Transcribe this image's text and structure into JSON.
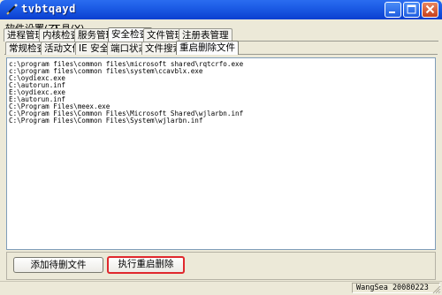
{
  "window": {
    "title": "tvbtqayd",
    "colors": {
      "titlebar": "#0a3fd0",
      "highlight_border": "#e0282d",
      "face": "#ece9d8"
    }
  },
  "menu": [
    {
      "label": "软件设置(Z)"
    },
    {
      "label": "工具(Y)"
    }
  ],
  "tabs_top": [
    {
      "label": "进程管理"
    },
    {
      "label": "内核检查"
    },
    {
      "label": "服务管理"
    },
    {
      "label": "安全检查",
      "active": true
    },
    {
      "label": "文件管理"
    },
    {
      "label": "注册表管理"
    }
  ],
  "tabs_sub": [
    {
      "label": "常规检查"
    },
    {
      "label": "活动文件"
    },
    {
      "label": "IE 安全"
    },
    {
      "label": "端口状态"
    },
    {
      "label": "文件搜索"
    },
    {
      "label": "重启删除文件",
      "active": true
    }
  ],
  "file_list": [
    "c:\\program files\\common files\\microsoft shared\\rqtcrfo.exe",
    "c:\\program files\\common files\\system\\ccavblx.exe",
    "C:\\oydiexc.exe",
    "C:\\autorun.inf",
    "E:\\oydiexc.exe",
    "E:\\autorun.inf",
    "C:\\Program Files\\meex.exe",
    "C:\\Program Files\\Common Files\\Microsoft Shared\\wjlarbn.inf",
    "C:\\Program Files\\Common Files\\System\\wjlarbn.inf"
  ],
  "buttons": {
    "add_label": "添加待删文件",
    "execute_label": "执行重启删除"
  },
  "status": {
    "text": "WangSea 20080223"
  }
}
